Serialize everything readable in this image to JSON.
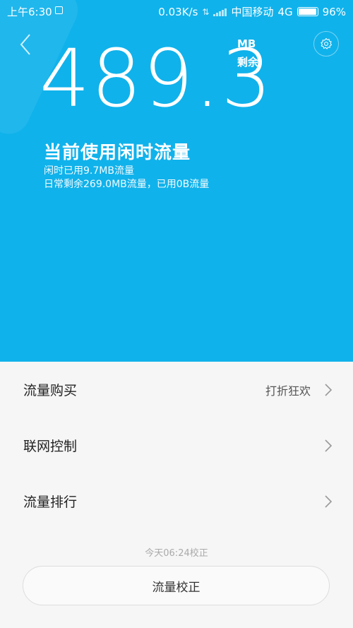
{
  "status_bar": {
    "time": "上午6:30",
    "speed": "0.03K/s",
    "carrier": "中国移动",
    "network": "4G",
    "battery_percent": "96%",
    "battery_level": 0.96
  },
  "hero": {
    "amount": "489.3",
    "unit": "MB",
    "remain_label": "剩余",
    "mode_title": "当前使用闲时流量",
    "idle_used": "闲时已用9.7MB流量",
    "daily_info": "日常剩余269.0MB流量，已用0B流量",
    "background_color": "#10b2eb"
  },
  "menu": {
    "items": [
      {
        "label": "流量购买",
        "extra": "打折狂欢"
      },
      {
        "label": "联网控制",
        "extra": ""
      },
      {
        "label": "流量排行",
        "extra": ""
      }
    ]
  },
  "footer": {
    "calibrate_time": "今天06:24校正",
    "calibrate_button": "流量校正"
  },
  "icons": {
    "back": "chevron-left-icon",
    "settings": "gear-icon",
    "chevron": "chevron-right-icon"
  }
}
